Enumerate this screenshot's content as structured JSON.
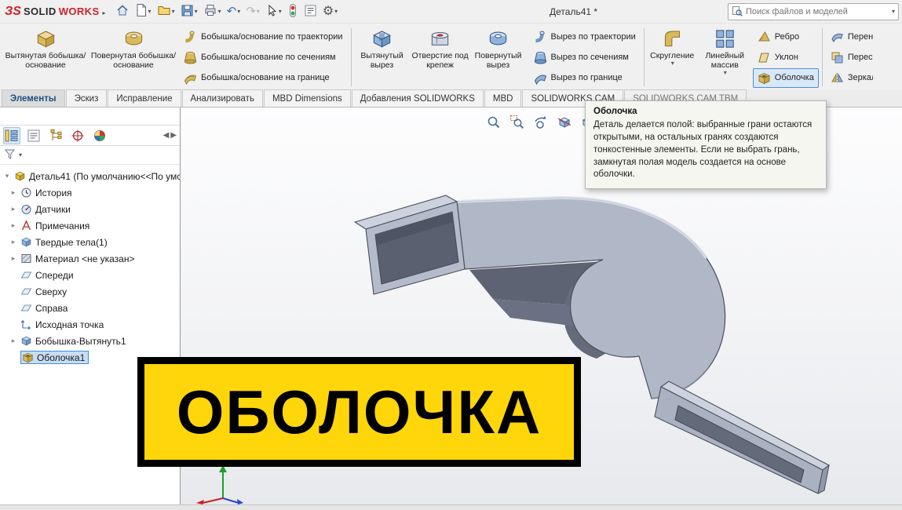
{
  "titlebar": {
    "logo_mark": "ЗS",
    "logo_solid": "SOLID",
    "logo_works": "WORKS",
    "document_title": "Деталь41 *",
    "search_placeholder": "Поиск файлов и моделей"
  },
  "ribbon": {
    "boss_large": [
      "Вытянутая бобышка/основание",
      "Повернутая бобышка/основание"
    ],
    "boss_stack": [
      "Бобышка/основание по траектории",
      "Бобышка/основание по сечениям",
      "Бобышка/основание на границе"
    ],
    "cut_large": [
      "Вытянутый вырез",
      "Отверстие под крепеж",
      "Повернутый вырез"
    ],
    "cut_stack": [
      "Вырез по траектории",
      "Вырез по сечениям",
      "Вырез по границе"
    ],
    "feature_large": [
      "Скругление",
      "Линейный массив"
    ],
    "feature_stack": [
      "Ребро",
      "Уклон",
      "Оболочка"
    ],
    "edge_stack": [
      "Перен",
      "Перес",
      "Зеркал"
    ]
  },
  "tabs": [
    "Элементы",
    "Эскиз",
    "Исправление",
    "Анализировать",
    "MBD Dimensions",
    "Добавления SOLIDWORKS",
    "MBD",
    "SOLIDWORKS CAM",
    "SOLIDWORKS CAM TBM"
  ],
  "tooltip": {
    "title": "Оболочка",
    "body": "Деталь делается полой: выбранные грани остаются открытыми, на остальных гранях создаются тонкостенные элементы. Если не выбрать грань, замкнутая полая модель создается на основе оболочки."
  },
  "tree": {
    "root": "Деталь41 (По умолчанию<<По умс",
    "items": [
      "История",
      "Датчики",
      "Примечания",
      "Твердые тела(1)",
      "Материал <не указан>",
      "Спереди",
      "Сверху",
      "Справа",
      "Исходная точка",
      "Бобышка-Вытянуть1",
      "Оболочка1"
    ]
  },
  "viewport": {
    "banner_text": "ОБОЛОЧКА"
  }
}
